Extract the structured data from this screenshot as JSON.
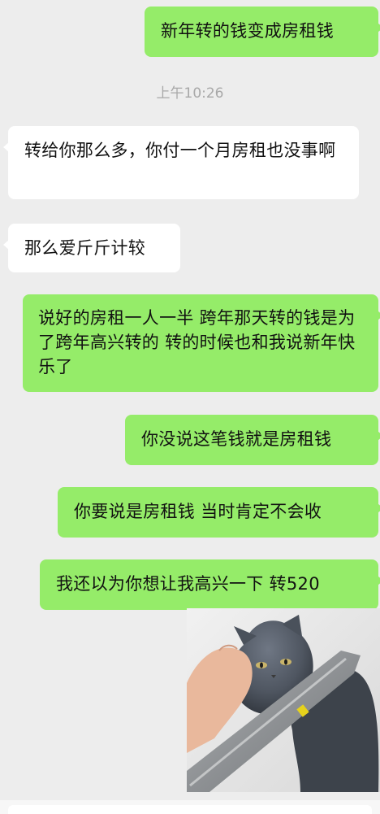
{
  "colors": {
    "sent_bubble": "#95EC69",
    "received_bubble": "#FFFFFF",
    "background": "#EDEDED",
    "timestamp_text": "#A8A8A8"
  },
  "chat": {
    "timestamp": "上午10:26",
    "messages": [
      {
        "direction": "sent",
        "text": "新年转的钱变成房租钱"
      },
      {
        "direction": "received",
        "text": "转给你那么多，你付一个月房租也没事啊"
      },
      {
        "direction": "received",
        "text": "那么爱斤斤计较"
      },
      {
        "direction": "sent",
        "text": "说好的房租一人一半 跨年那天转的钱是为了跨年高兴转的 转的时候也和我说新年快乐了"
      },
      {
        "direction": "sent",
        "text": "你没说这笔钱就是房租钱"
      },
      {
        "direction": "sent",
        "text": "你要说是房租钱 当时肯定不会收"
      },
      {
        "direction": "sent",
        "text": "我还以为你想让我高兴一下 转520"
      },
      {
        "direction": "sent",
        "type": "image",
        "icon": "cat-knife-meme-image"
      }
    ]
  }
}
